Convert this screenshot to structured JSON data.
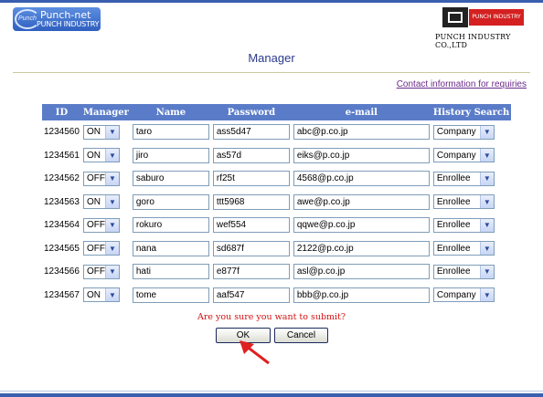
{
  "header": {
    "logo_left_main": "Punch-net",
    "logo_left_sub": "PUNCH INDUSTRY",
    "logo_left_mini": "Punch",
    "logo_right_text": "PUNCH INDUSTRY",
    "company_name": "PUNCH INDUSTRY CO.,LTD"
  },
  "page": {
    "title": "Manager",
    "contact_link": "Contact information for requiries",
    "confirm_text": "Are you sure you want to submit?",
    "ok_label": "OK",
    "cancel_label": "Cancel"
  },
  "table": {
    "headers": [
      "ID",
      "Manager",
      "Name",
      "Password",
      "e-mail",
      "History Search"
    ],
    "rows": [
      {
        "id": "1234560",
        "manager": "ON",
        "name": "taro",
        "password": "ass5d47",
        "email": "abc@p.co.jp",
        "history": "Company"
      },
      {
        "id": "1234561",
        "manager": "ON",
        "name": "jiro",
        "password": "as57d",
        "email": "eiks@p.co.jp",
        "history": "Company"
      },
      {
        "id": "1234562",
        "manager": "OFF",
        "name": "saburo",
        "password": "rf25t",
        "email": "4568@p.co.jp",
        "history": "Enrollee"
      },
      {
        "id": "1234563",
        "manager": "ON",
        "name": "goro",
        "password": "ttt5968",
        "email": "awe@p.co.jp",
        "history": "Enrollee"
      },
      {
        "id": "1234564",
        "manager": "OFF",
        "name": "rokuro",
        "password": "wef554",
        "email": "qqwe@p.co.jp",
        "history": "Enrollee"
      },
      {
        "id": "1234565",
        "manager": "OFF",
        "name": "nana",
        "password": "sd687f",
        "email": "2122@p.co.jp",
        "history": "Enrollee"
      },
      {
        "id": "1234566",
        "manager": "OFF",
        "name": "hati",
        "password": "e877f",
        "email": "asl@p.co.jp",
        "history": "Enrollee"
      },
      {
        "id": "1234567",
        "manager": "ON",
        "name": "tome",
        "password": "aaf547",
        "email": "bbb@p.co.jp",
        "history": "Company"
      }
    ]
  },
  "colors": {
    "frame": "#3a5fb0",
    "table_header": "#5a7cc8",
    "confirm_text": "#d41010",
    "title_text": "#2a3a8c",
    "pointer_arrow": "#e02020"
  },
  "icons": {
    "dropdown": "chevron-down-icon",
    "pointer": "red-arrow-pointer-icon"
  }
}
